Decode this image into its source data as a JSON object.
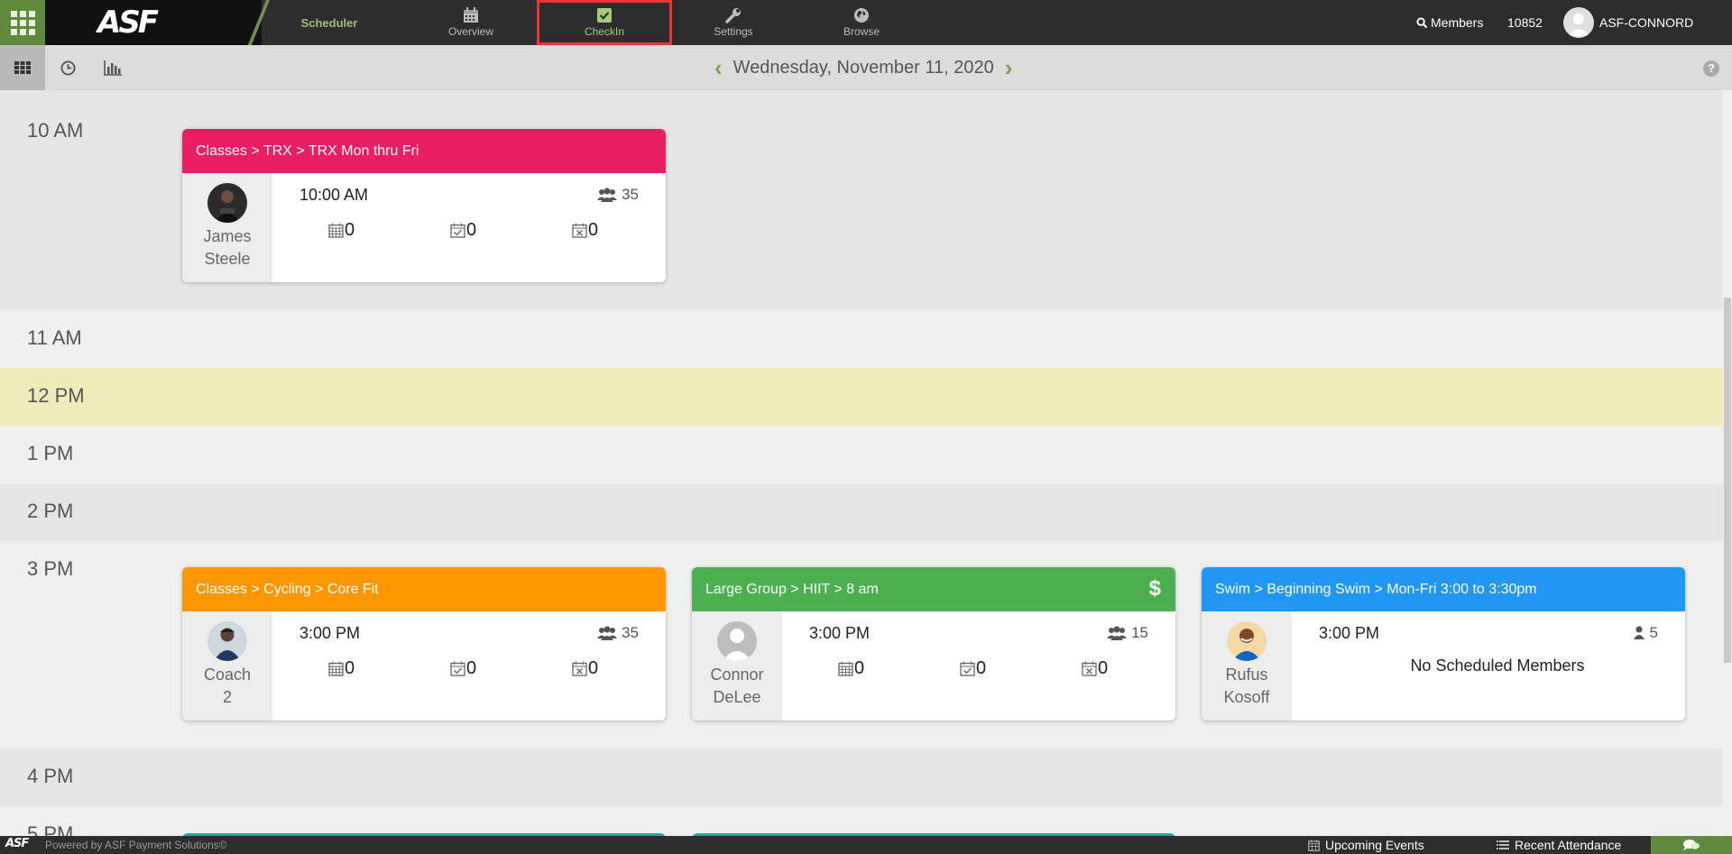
{
  "nav": {
    "scheduler": "Scheduler",
    "items": [
      {
        "label": "Overview",
        "icon": "calendar-icon"
      },
      {
        "label": "CheckIn",
        "icon": "check-square-icon"
      },
      {
        "label": "Settings",
        "icon": "wrench-icon"
      },
      {
        "label": "Browse",
        "icon": "globe-icon"
      }
    ],
    "members_label": "Members",
    "members_count": "10852",
    "user": "ASF-CONNORD",
    "logo": "ASF"
  },
  "subbar": {
    "date": "Wednesday, November 11, 2020",
    "views": [
      "grid-view-icon",
      "clock-icon",
      "bar-chart-icon"
    ]
  },
  "hours": [
    "10 AM",
    "11 AM",
    "12 PM",
    "1 PM",
    "2 PM",
    "3 PM",
    "4 PM",
    "5 PM"
  ],
  "classes": [
    {
      "title": "Classes > TRX > TRX Mon thru Fri",
      "color": "#e91e63",
      "instructor": [
        "James",
        "Steele"
      ],
      "time": "10:00 AM",
      "capacity": "35",
      "scheduled": "0",
      "checked_in": "0",
      "cancelled": "0"
    },
    {
      "title": "Classes > Cycling > Core Fit",
      "color": "#ff9800",
      "instructor": [
        "Coach",
        "2"
      ],
      "time": "3:00 PM",
      "capacity": "35",
      "scheduled": "0",
      "checked_in": "0",
      "cancelled": "0"
    },
    {
      "title": "Large Group > HIIT > 8 am",
      "color": "#4caf50",
      "paid": "$",
      "instructor": [
        "Connor",
        "DeLee"
      ],
      "time": "3:00 PM",
      "capacity": "15",
      "scheduled": "0",
      "checked_in": "0",
      "cancelled": "0"
    },
    {
      "title": "Swim > Beginning Swim > Mon-Fri 3:00 to 3:30pm",
      "color": "#2196f3",
      "instructor": [
        "Rufus",
        "Kosoff"
      ],
      "time": "3:00 PM",
      "capacity": "5",
      "empty_text": "No Scheduled Members"
    }
  ],
  "footer": {
    "logo": "ASF",
    "powered": "Powered by ASF Payment Solutions©",
    "upcoming": "Upcoming Events",
    "recent": "Recent Attendance"
  }
}
